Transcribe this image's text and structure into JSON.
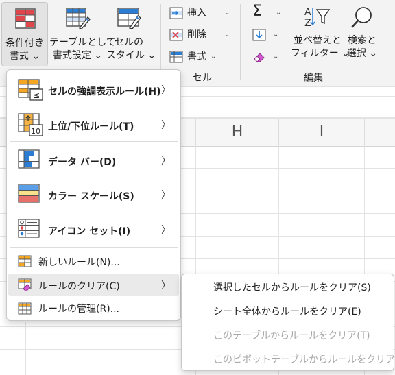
{
  "ribbon": {
    "conditional_formatting": {
      "line1": "条件付き",
      "line2": "書式 ⌄"
    },
    "format_as_table": {
      "line1": "テーブルとして",
      "line2": "書式設定 ⌄"
    },
    "cell_styles": {
      "line1": "セルの",
      "line2": "スタイル ⌄"
    },
    "cells": {
      "insert": "挿入",
      "delete": "削除",
      "format": "書式",
      "group_label": "セル"
    },
    "editing": {
      "sort_filter_line1": "並べ替えと",
      "sort_filter_line2": "フィルター ⌄",
      "find_line1": "検索と",
      "find_line2": "選択 ⌄",
      "group_label": "編集"
    }
  },
  "sheet": {
    "columns": [
      "H",
      "I"
    ]
  },
  "menu": {
    "items": [
      {
        "label": "セルの強調表示ルール(H)",
        "mnemonic": "H",
        "bold": true,
        "submenu": true
      },
      {
        "label": "上位/下位ルール(T)",
        "mnemonic": "T",
        "bold": true,
        "submenu": true
      },
      {
        "label": "データ バー(D)",
        "mnemonic": "D",
        "bold": true,
        "submenu": true
      },
      {
        "label": "カラー スケール(S)",
        "mnemonic": "S",
        "bold": true,
        "submenu": true
      },
      {
        "label": "アイコン セット(I)",
        "mnemonic": "I",
        "bold": true,
        "submenu": true
      },
      {
        "label": "新しいルール(N)...",
        "mnemonic": "N",
        "bold": false,
        "submenu": false
      },
      {
        "label": "ルールのクリア(C)",
        "mnemonic": "C",
        "bold": false,
        "submenu": true,
        "highlighted": true
      },
      {
        "label": "ルールの管理(R)...",
        "mnemonic": "R",
        "bold": false,
        "submenu": false
      }
    ]
  },
  "submenu": {
    "items": [
      {
        "label": "選択したセルからルールをクリア(S)",
        "enabled": true
      },
      {
        "label": "シート全体からルールをクリア(E)",
        "enabled": true
      },
      {
        "label": "このテーブルからルールをクリア(T)",
        "enabled": false
      },
      {
        "label": "このピボットテーブルからルールをクリア(P)",
        "enabled": false
      }
    ]
  },
  "colors": {
    "accent_blue": "#2b7cd3",
    "accent_red": "#e0474c",
    "ribbon_bg": "#f3f3f3",
    "hover": "#eaeaea",
    "disabled_text": "#a8a8a8"
  }
}
